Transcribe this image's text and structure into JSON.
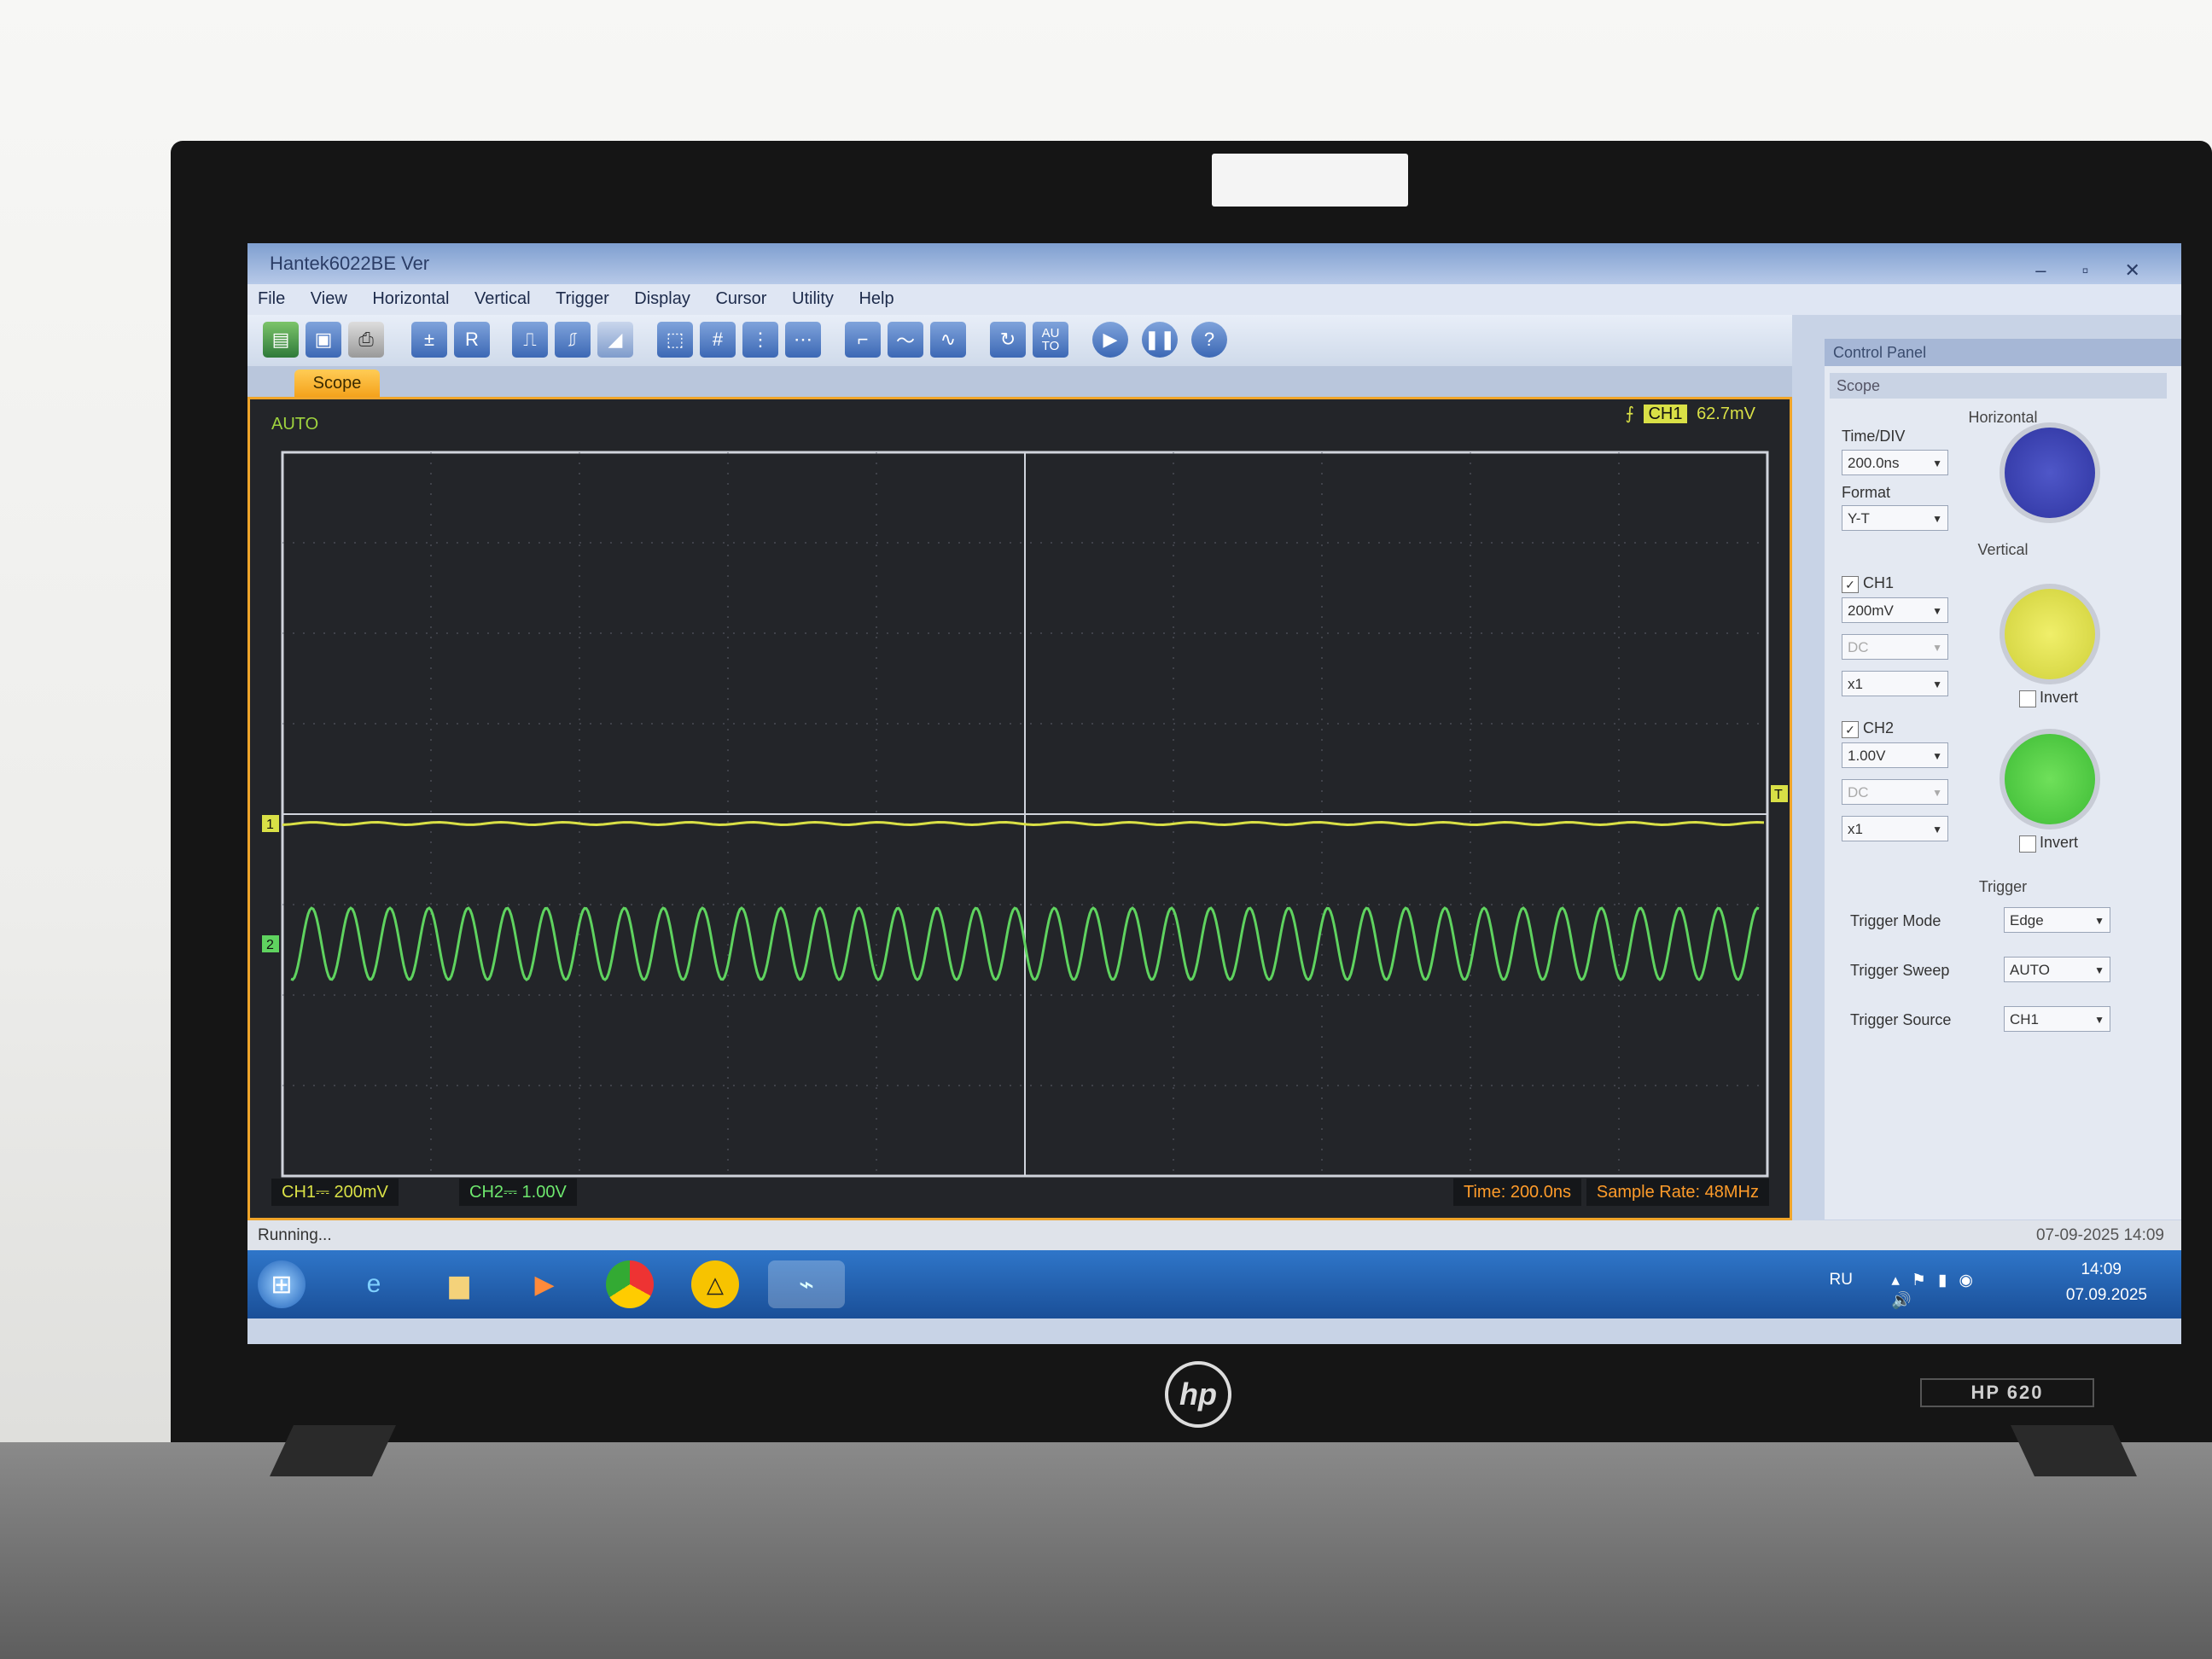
{
  "window": {
    "title": "Hantek6022BE Ver"
  },
  "menu": [
    "File",
    "View",
    "Horizontal",
    "Vertical",
    "Trigger",
    "Display",
    "Cursor",
    "Utility",
    "Help"
  ],
  "toolbar": {
    "buttons": [
      "open",
      "save",
      "print",
      "math",
      "ref",
      "rising-edge",
      "falling-edge",
      "slope",
      "select",
      "grid",
      "cursor-vertical",
      "cursor-horizontal",
      "step",
      "line",
      "sine",
      "reset",
      "auto",
      "run",
      "pause",
      "help"
    ],
    "auto_label": "AU\nTO",
    "ref_label": "R",
    "help_label": "?"
  },
  "tab": {
    "label": "Scope"
  },
  "scope": {
    "mode": "AUTO",
    "trigger_source": "CH1",
    "trigger_level": "62.7mV",
    "ch1_marker": "1",
    "ch2_marker": "2",
    "trigger_marker": "T",
    "ch1_status": "CH1⎓  200mV",
    "ch2_status": "CH2⎓  1.00V",
    "time_status": "Time: 200.0ns",
    "rate_status": "Sample Rate: 48MHz",
    "ch1_color": "#d9e046",
    "ch2_color": "#5fd35f"
  },
  "control_panel": {
    "title": "Control Panel",
    "selected": "Scope",
    "horizontal": {
      "heading": "Horizontal",
      "time_div_label": "Time/DIV",
      "time_div": "200.0ns",
      "format_label": "Format",
      "format": "Y-T"
    },
    "vertical": {
      "heading": "Vertical",
      "ch1": {
        "label": "CH1",
        "enabled": true,
        "volts": "200mV",
        "coupling": "DC",
        "probe": "x1",
        "invert_label": "Invert"
      },
      "ch2": {
        "label": "CH2",
        "enabled": true,
        "volts": "1.00V",
        "coupling": "DC",
        "probe": "x1",
        "invert_label": "Invert"
      }
    },
    "trigger": {
      "heading": "Trigger",
      "mode_label": "Trigger Mode",
      "mode": "Edge",
      "sweep_label": "Trigger Sweep",
      "sweep": "AUTO",
      "source_label": "Trigger Source",
      "source": "CH1"
    }
  },
  "status": {
    "left": "Running...",
    "right": "07-09-2025 14:09"
  },
  "taskbar": {
    "language": "RU",
    "time": "14:09",
    "date": "07.09.2025"
  },
  "laptop": {
    "brand": "hp",
    "model": "HP 620"
  }
}
